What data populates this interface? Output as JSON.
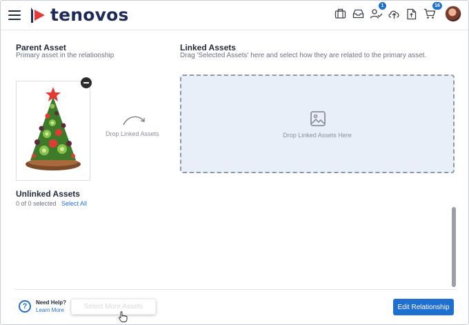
{
  "header": {
    "brand": "tenovos",
    "icons": [
      "briefcase-icon",
      "inbox-icon",
      "users-check-icon",
      "upload-cloud-icon",
      "file-export-icon",
      "cart-icon"
    ],
    "notification_badge": "1",
    "cart_badge": "16"
  },
  "parent": {
    "title": "Parent Asset",
    "subtitle": "Primary asset in the relationship"
  },
  "linked": {
    "title": "Linked Assets",
    "subtitle": "Drag 'Selected Assets' here and select how they are related to the primary asset.",
    "drop_here": "Drop Linked Assets Here"
  },
  "drop_hint": "Drop Linked Assets",
  "unlinked": {
    "title": "Unlinked Assets",
    "count": "0 of 0 selected",
    "select_all": "Select All"
  },
  "footer": {
    "need_help": "Need Help?",
    "learn_more": "Learn More",
    "select_more": "Select More Assets",
    "edit_relationship": "Edit Relationship"
  },
  "colors": {
    "accent": "#1f6fd1",
    "brand_navy": "#1f2a5a",
    "dropzone_bg": "#e9eff8"
  }
}
